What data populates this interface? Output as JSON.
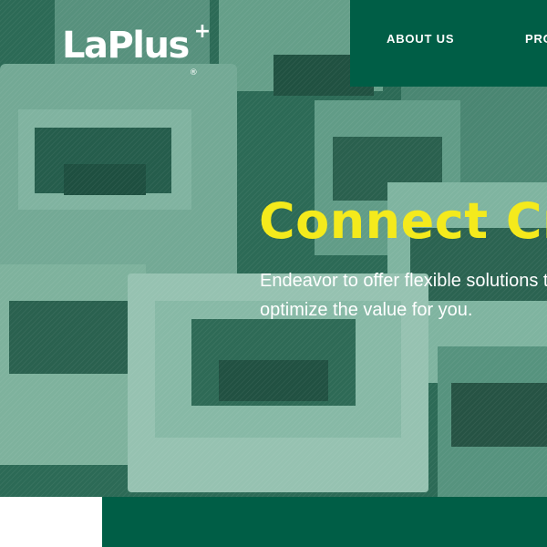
{
  "brand": {
    "logo_text": "LaPlus",
    "logo_plus": "+",
    "logo_reg": "®"
  },
  "nav": {
    "items": [
      {
        "label": "ABOUT US"
      },
      {
        "label": "PRODUCTS"
      }
    ]
  },
  "hero": {
    "headline": "Connect Creativity",
    "subtext_line1": "Endeavor to offer flexible solutions to",
    "subtext_line2": "optimize the value for you."
  },
  "colors": {
    "brand_green": "#005e46",
    "hero_teal": "#2f6e5a",
    "headline_yellow": "#f4ea1c"
  }
}
